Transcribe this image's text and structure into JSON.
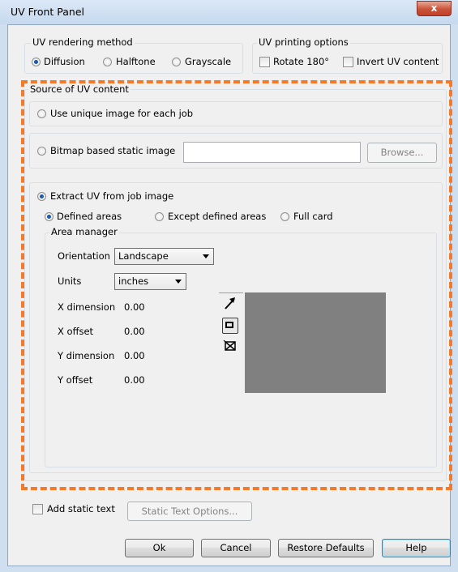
{
  "window": {
    "title": "UV Front Panel",
    "close_glyph": "x"
  },
  "rendering": {
    "legend": "UV rendering method",
    "options": [
      "Diffusion",
      "Halftone",
      "Grayscale"
    ],
    "selected": "Diffusion"
  },
  "printing": {
    "legend": "UV printing options",
    "rotate_label": "Rotate 180°",
    "invert_label": "Invert UV content",
    "rotate_checked": false,
    "invert_checked": false
  },
  "source": {
    "legend": "Source of UV content",
    "unique_label": "Use unique image for each job",
    "bitmap_label": "Bitmap based static image",
    "bitmap_path": "",
    "browse_label": "Browse...",
    "extract_label": "Extract UV from job image",
    "selected": "Extract UV from job image",
    "area_options": [
      "Defined areas",
      "Except defined areas",
      "Full card"
    ],
    "area_selected": "Defined areas"
  },
  "area_manager": {
    "legend": "Area manager",
    "orientation_label": "Orientation",
    "orientation_value": "Landscape",
    "units_label": "Units",
    "units_value": "inches",
    "x_dim_label": "X dimension",
    "x_dim_value": "0.00",
    "x_off_label": "X offset",
    "x_off_value": "0.00",
    "y_dim_label": "Y dimension",
    "y_dim_value": "0.00",
    "y_off_label": "Y offset",
    "y_off_value": "0.00",
    "tools": [
      "arrow-pointer-icon",
      "rectangle-tool-icon",
      "delete-area-icon"
    ],
    "preview_color": "#808080"
  },
  "static_text": {
    "label": "Add static text",
    "checked": false,
    "options_label": "Static Text Options..."
  },
  "buttons": {
    "ok": "Ok",
    "cancel": "Cancel",
    "restore": "Restore Defaults",
    "help": "Help"
  },
  "colors": {
    "highlight_dash": "#f47a2a",
    "close_button": "#c95438",
    "window_frame": "#cfdff0"
  }
}
